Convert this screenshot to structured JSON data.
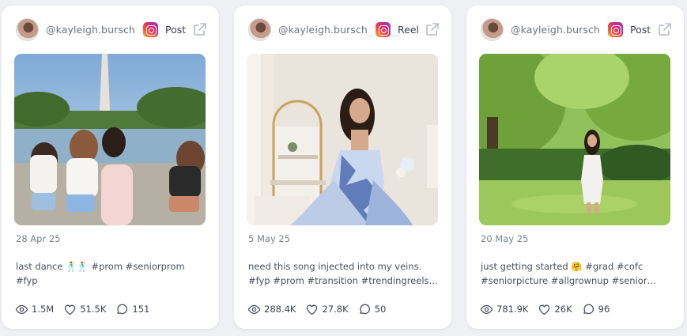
{
  "posts": [
    {
      "handle": "@kayleigh.bursch",
      "platform_icon": "instagram-icon",
      "type": "Post",
      "date": "28 Apr 25",
      "caption": "last dance 🕺🕺 #prom #seniorprom #fyp",
      "views": "1.5M",
      "likes": "51.5K",
      "comments": "151"
    },
    {
      "handle": "@kayleigh.bursch",
      "platform_icon": "instagram-icon",
      "type": "Reel",
      "date": "5 May 25",
      "caption": "need this song injected into my veins. #fyp #prom #transition #trendingreels…",
      "views": "288.4K",
      "likes": "27.8K",
      "comments": "50"
    },
    {
      "handle": "@kayleigh.bursch",
      "platform_icon": "instagram-icon",
      "type": "Post",
      "date": "20 May 25",
      "caption": "just getting started 🤗 #grad #cofc #seniorpicture #allgrownup #senior…",
      "views": "781.9K",
      "likes": "26K",
      "comments": "96"
    }
  ],
  "colors": {
    "background": "#eef0f4",
    "card": "#ffffff",
    "text_muted": "#7b8190",
    "instagram_gradient": [
      "#fdb44b",
      "#f6592f",
      "#d72b7b",
      "#8a3ab9"
    ]
  }
}
